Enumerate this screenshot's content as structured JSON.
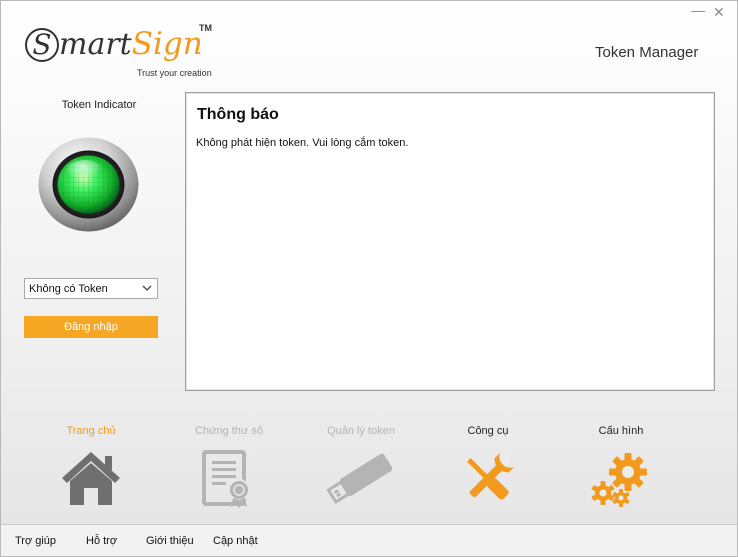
{
  "window": {
    "minimize_glyph": "—",
    "close_glyph": "✕"
  },
  "logo": {
    "s": "S",
    "mart": "mart",
    "sign": "Sign",
    "tm": "TM",
    "tagline": "Trust your creation"
  },
  "app_title": "Token Manager",
  "left_panel": {
    "indicator_label": "Token Indicator",
    "indicator_status_color": "#2ee84a",
    "token_select_value": "Không có Token",
    "login_label": "Đăng nhập"
  },
  "message": {
    "title": "Thông báo",
    "body": "Không phát hiện token. Vui lòng cắm token."
  },
  "nav": {
    "home": "Trang chủ",
    "certificate": "Chứng thư số",
    "token_manage": "Quản lý token",
    "tools": "Công cụ",
    "config": "Cấu hình"
  },
  "footer": {
    "help": "Trợ giúp",
    "support": "Hỗ trợ",
    "about": "Giới thiệu",
    "update": "Cập nhật"
  },
  "colors": {
    "accent": "#f29a1d",
    "button": "#f5a623",
    "disabled": "#b4b4b4",
    "icon_dark": "#6f6f6f"
  },
  "icons": {
    "home": "house-icon",
    "certificate": "certificate-document-icon",
    "token_manage": "usb-token-icon",
    "tools": "wrench-screwdriver-icon",
    "config": "gears-icon",
    "indicator": "status-light-icon",
    "dropdown": "chevron-down-icon"
  }
}
